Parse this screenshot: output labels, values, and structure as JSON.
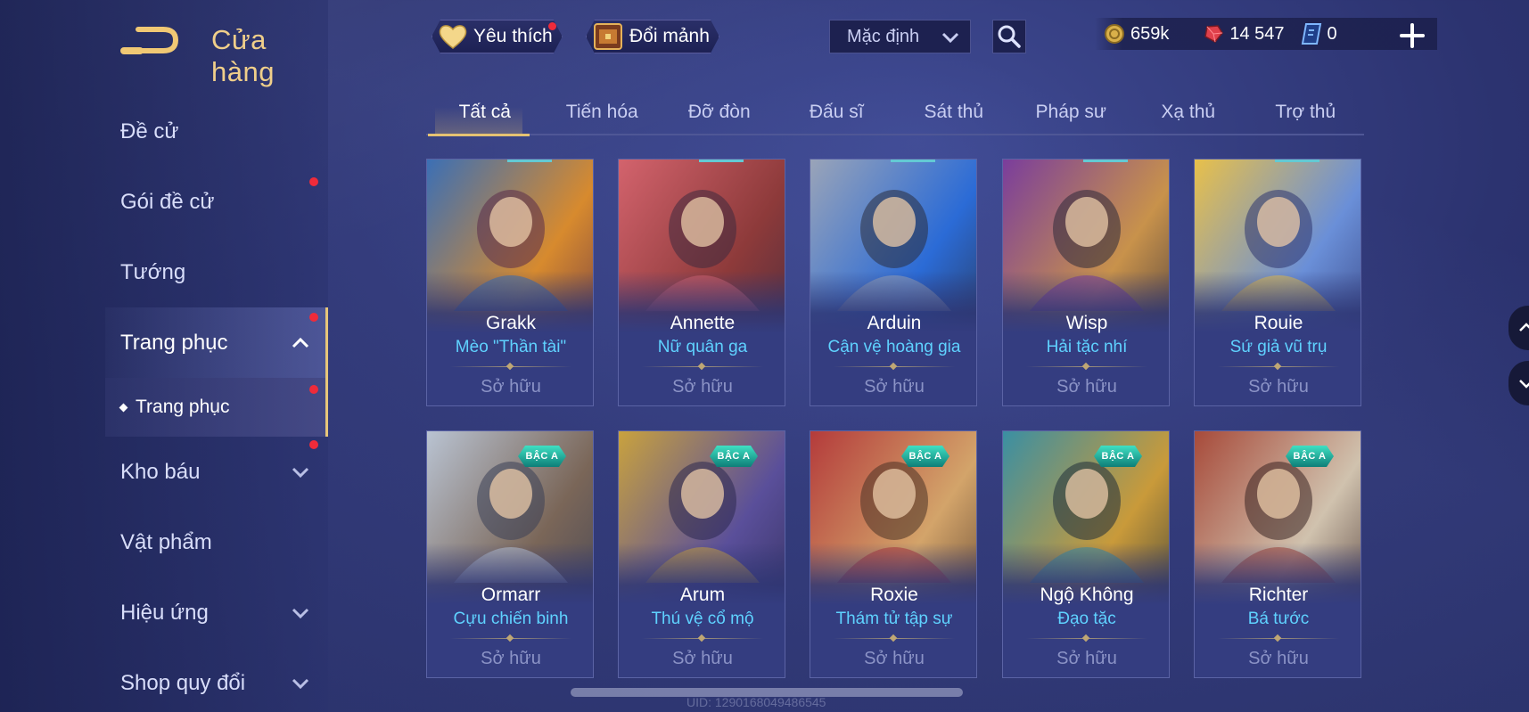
{
  "header": {
    "title": "Cửa hàng",
    "back_icon": "back-arrow-icon",
    "accent_color": "#f0cf8a"
  },
  "topbar": {
    "favorites_label": "Yêu thích",
    "exchange_label": "Đổi mảnh",
    "sort": {
      "selected": "Mặc định"
    },
    "currencies": [
      {
        "icon": "gold-coin-icon",
        "value": "659k",
        "color": "#d9b04a"
      },
      {
        "icon": "ruby-gem-icon",
        "value": "14 547",
        "color": "#e0404b"
      },
      {
        "icon": "voucher-icon",
        "value": "0",
        "color": "#7fb7ff"
      }
    ]
  },
  "sidebar": {
    "items": [
      {
        "label": "Đề cử"
      },
      {
        "label": "Gói đề cử"
      },
      {
        "label": "Tướng"
      },
      {
        "label": "Trang phục"
      },
      {
        "label": "Trang phục"
      },
      {
        "label": "Kho báu"
      },
      {
        "label": "Vật phẩm"
      },
      {
        "label": "Hiệu ứng"
      },
      {
        "label": "Shop quy đổi"
      }
    ]
  },
  "tabs": [
    {
      "label": "Tất cả"
    },
    {
      "label": "Tiến hóa"
    },
    {
      "label": "Đỡ đòn"
    },
    {
      "label": "Đấu sĩ"
    },
    {
      "label": "Sát thủ"
    },
    {
      "label": "Pháp sư"
    },
    {
      "label": "Xạ thủ"
    },
    {
      "label": "Trợ thủ"
    }
  ],
  "cards": [
    {
      "hero": "Grakk",
      "skin": "Mèo \"Thần tài\"",
      "status": "Sở hữu",
      "badge": "",
      "colors": [
        "#3b6fb5",
        "#d78a2e",
        "#5a2b4a"
      ]
    },
    {
      "hero": "Annette",
      "skin": "Nữ quân ga",
      "status": "Sở hữu",
      "badge": "",
      "colors": [
        "#d3636d",
        "#8d3a3a",
        "#3e2a3e"
      ]
    },
    {
      "hero": "Arduin",
      "skin": "Cận vệ hoàng gia",
      "status": "Sở hữu",
      "badge": "",
      "colors": [
        "#9aa4b8",
        "#2b6bd6",
        "#2a2d3e"
      ]
    },
    {
      "hero": "Wisp",
      "skin": "Hải tặc nhí",
      "status": "Sở hữu",
      "badge": "",
      "colors": [
        "#7a3d9c",
        "#c8924b",
        "#2e2a3a"
      ]
    },
    {
      "hero": "Rouie",
      "skin": "Sứ giả vũ trụ",
      "status": "Sở hữu",
      "badge": "",
      "colors": [
        "#e8c04a",
        "#6a8fd8",
        "#2d3570"
      ]
    },
    {
      "hero": "Ormarr",
      "skin": "Cựu chiến binh",
      "status": "Sở hữu",
      "badge": "BẬC A",
      "colors": [
        "#b9c3d2",
        "#7a6658",
        "#3a3f55"
      ]
    },
    {
      "hero": "Arum",
      "skin": "Thú vệ cổ mộ",
      "status": "Sở hữu",
      "badge": "BẬC A",
      "colors": [
        "#c9a23e",
        "#5a4f9a",
        "#2b2850"
      ]
    },
    {
      "hero": "Roxie",
      "skin": "Thám tử tập sự",
      "status": "Sở hữu",
      "badge": "BẬC A",
      "colors": [
        "#b43b3b",
        "#d3a46a",
        "#4a3326"
      ]
    },
    {
      "hero": "Ngộ Không",
      "skin": "Đạo tặc",
      "status": "Sở hữu",
      "badge": "BẬC A",
      "colors": [
        "#3a8fa3",
        "#c99a3a",
        "#1f2e3a"
      ]
    },
    {
      "hero": "Richter",
      "skin": "Bá tước",
      "status": "Sở hữu",
      "badge": "BẬC A",
      "colors": [
        "#a74a3a",
        "#d0c2ae",
        "#3a2422"
      ]
    }
  ],
  "footer": {
    "uid": "UID: 1290168049486545"
  }
}
